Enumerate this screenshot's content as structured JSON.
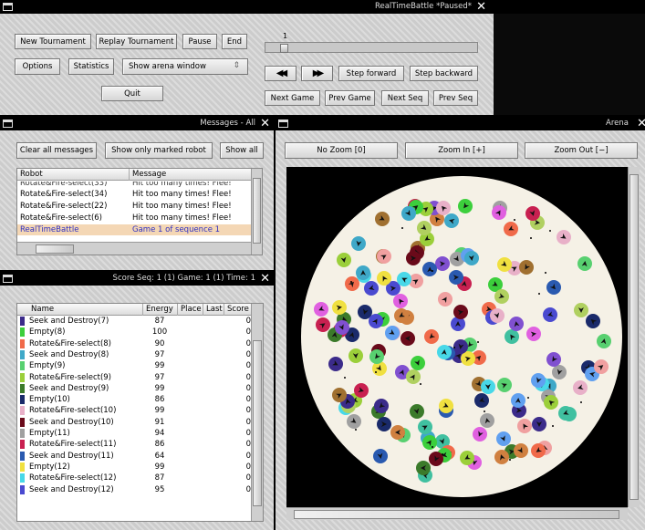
{
  "main_window": {
    "title": "RealTimeBattle *Paused*",
    "buttons": {
      "new_tournament": "New Tournament",
      "replay_tournament": "Replay Tournament",
      "pause": "Pause",
      "end": "End",
      "options": "Options",
      "statistics": "Statistics",
      "show_arena": "Show arena window",
      "quit": "Quit"
    },
    "slider_value": "1",
    "replay": {
      "rewind_icon": "rewind-icon",
      "fast_forward_icon": "fast-forward-icon",
      "step_forward": "Step forward",
      "step_backward": "Step backward",
      "next_game": "Next Game",
      "prev_game": "Prev Game",
      "next_seq": "Next Seq",
      "prev_seq": "Prev Seq"
    }
  },
  "messages_window": {
    "title": "Messages -  All",
    "buttons": {
      "clear": "Clear all messages",
      "only_marked": "Show only marked robot",
      "show_all": "Show all"
    },
    "columns": [
      "Robot",
      "Message"
    ],
    "rows": [
      {
        "robot": "Rotate&Fire-select(34)",
        "message": "Hit too many times! Flee!"
      },
      {
        "robot": "Rotate&Fire-select(22)",
        "message": "Hit too many times! Flee!"
      },
      {
        "robot": "Rotate&Fire-select(6)",
        "message": "Hit too many times! Flee!"
      },
      {
        "robot": "RealTimeBattle",
        "message": "Game 1 of sequence 1",
        "highlight": true
      }
    ]
  },
  "score_window": {
    "title": "Score   Seq: 1 (1)  Game: 1 (1)  Time: 1",
    "columns": [
      "Name",
      "Energy",
      "Place",
      "Last",
      "Score"
    ],
    "rows": [
      {
        "color": "#3b2b8a",
        "name": "Seek and Destroy(7)",
        "energy": "87",
        "score": "0"
      },
      {
        "color": "#3ccf3c",
        "name": "Empty(8)",
        "energy": "100",
        "score": "0"
      },
      {
        "color": "#f06a4a",
        "name": "Rotate&Fire-select(8)",
        "energy": "90",
        "score": "0"
      },
      {
        "color": "#3fa8c8",
        "name": "Seek and Destroy(8)",
        "energy": "97",
        "score": "0"
      },
      {
        "color": "#58d070",
        "name": "Empty(9)",
        "energy": "99",
        "score": "0"
      },
      {
        "color": "#9bcf3a",
        "name": "Rotate&Fire-select(9)",
        "energy": "97",
        "score": "0"
      },
      {
        "color": "#3b7a2a",
        "name": "Seek and Destroy(9)",
        "energy": "99",
        "score": "0"
      },
      {
        "color": "#1a2a6a",
        "name": "Empty(10)",
        "energy": "86",
        "score": "0"
      },
      {
        "color": "#e8b0c8",
        "name": "Rotate&Fire-select(10)",
        "energy": "99",
        "score": "0"
      },
      {
        "color": "#6a0a1a",
        "name": "Seek and Destroy(10)",
        "energy": "91",
        "score": "0"
      },
      {
        "color": "#a0a0a0",
        "name": "Empty(11)",
        "energy": "94",
        "score": "0"
      },
      {
        "color": "#c82050",
        "name": "Rotate&Fire-select(11)",
        "energy": "86",
        "score": "0"
      },
      {
        "color": "#2a5ab0",
        "name": "Seek and Destroy(11)",
        "energy": "64",
        "score": "0"
      },
      {
        "color": "#f0e040",
        "name": "Empty(12)",
        "energy": "99",
        "score": "0"
      },
      {
        "color": "#48d8e8",
        "name": "Rotate&Fire-select(12)",
        "energy": "87",
        "score": "0"
      },
      {
        "color": "#4a4ad0",
        "name": "Seek and Destroy(12)",
        "energy": "95",
        "score": "0"
      }
    ]
  },
  "arena_window": {
    "title": "Arena",
    "buttons": {
      "no_zoom": "No Zoom [0]",
      "zoom_in": "Zoom In [+]",
      "zoom_out": "Zoom Out [−]"
    }
  }
}
